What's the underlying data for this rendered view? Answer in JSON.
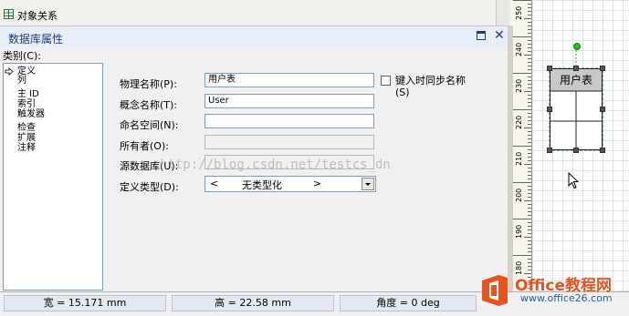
{
  "top_panel": {
    "title": "对象关系"
  },
  "prop_window": {
    "title": "数据库属性",
    "category_label": "类别(C):",
    "categories": [
      "定义",
      "列",
      "主 ID",
      "索引",
      "触发器",
      "检查",
      "扩展",
      "注释"
    ],
    "fields": [
      {
        "label": "物理名称(P):",
        "value": "用户表",
        "disabled": false
      },
      {
        "label": "概念名称(T):",
        "value": "User",
        "disabled": false
      },
      {
        "label": "命名空间(N):",
        "value": "",
        "disabled": false
      },
      {
        "label": "所有者(O):",
        "value": "",
        "disabled": true
      },
      {
        "label": "源数据库(U):",
        "value": "",
        "disabled": true
      }
    ],
    "sync_checkbox": {
      "label": "键入时同步名称(S)",
      "checked": false
    },
    "type_field": {
      "label": "定义类型(D):",
      "left": "<",
      "value": "无类型化",
      "right": ">"
    },
    "watermark": "http://blog.csdn.net/testcs_dn"
  },
  "status_bar": {
    "width": "宽 = 15.171 mm",
    "height": "高 = 22.58 mm",
    "angle": "角度 = 0 deg"
  },
  "ruler": {
    "labels": [
      "250",
      "240",
      "230",
      "220",
      "210",
      "200",
      "190",
      "180"
    ]
  },
  "entity": {
    "title": "用户表"
  },
  "logo": {
    "brand": "Office教程网",
    "url": "www.office26.com"
  },
  "colors": {
    "accent": "#1c3e7a",
    "logo_orange": "#e8541f"
  }
}
